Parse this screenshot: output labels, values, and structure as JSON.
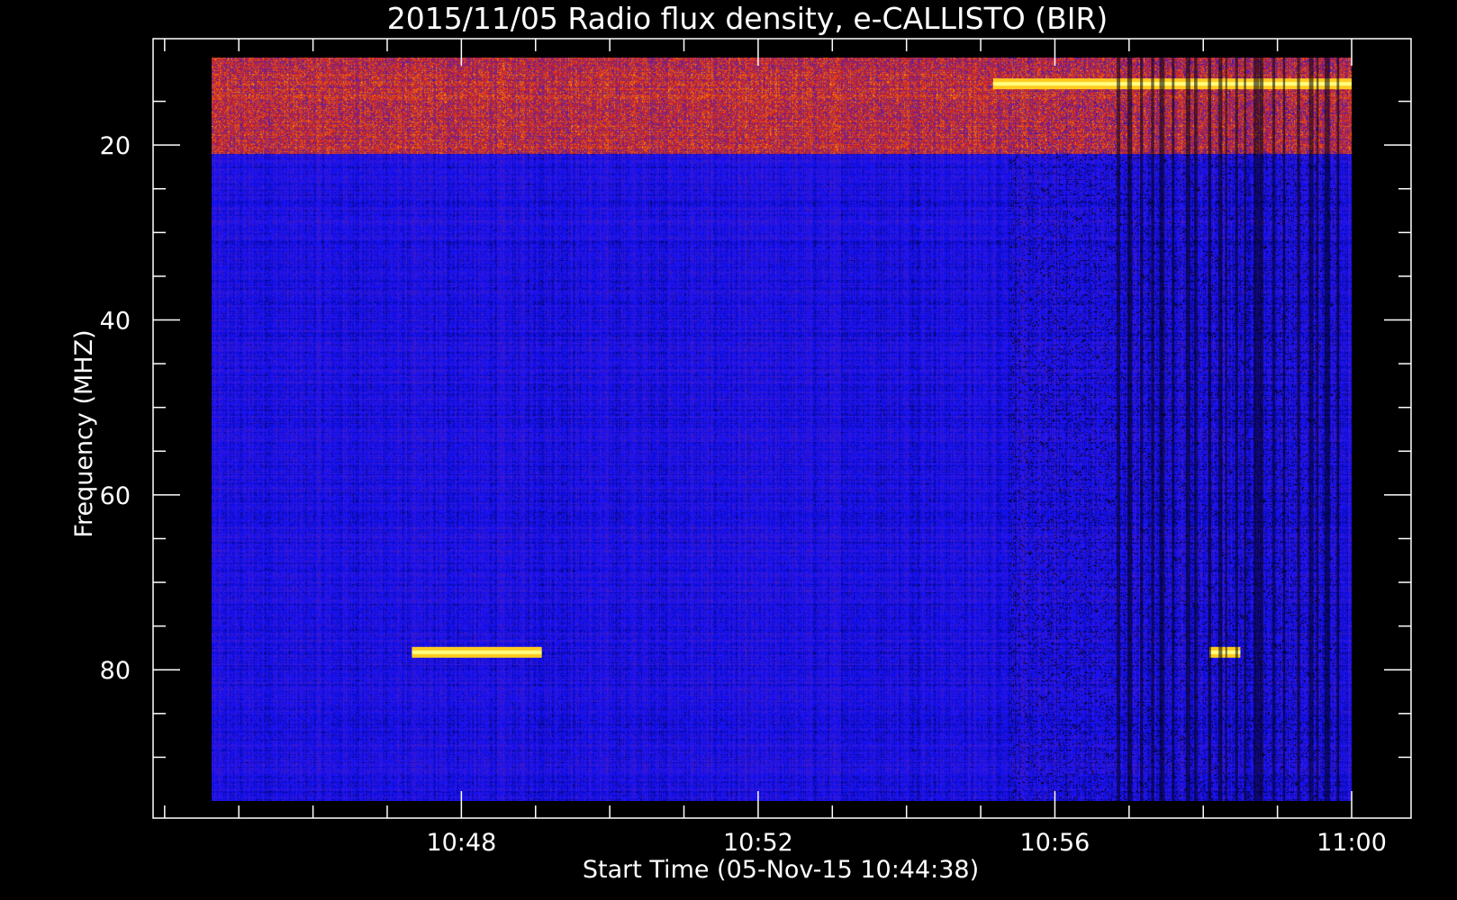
{
  "chart_data": {
    "type": "heatmap",
    "title": "2015/11/05  Radio flux density, e-CALLISTO (BIR)",
    "xlabel": "Start Time (05-Nov-15 10:44:38)",
    "ylabel": "Frequency (MHZ)",
    "x_range": [
      "10:44:38",
      "11:00:00"
    ],
    "y_range": [
      10,
      95
    ],
    "axis_inverted_y": true,
    "x_ticks": [
      "10:48",
      "10:52",
      "10:56",
      "11:00"
    ],
    "y_ticks": [
      20,
      40,
      60,
      80
    ],
    "colormap": [
      "#000000",
      "#1010ff",
      "#6020a0",
      "#d02020",
      "#ff8000",
      "#ffff60"
    ],
    "features": [
      {
        "label": "RFI band",
        "time_start": "10:44:38",
        "time_end": "11:00:00",
        "freq_start": 10,
        "freq_end": 21
      },
      {
        "label": "narrowband 78 MHz",
        "time_start": "10:47:20",
        "time_end": "10:49:05",
        "freq": 78
      },
      {
        "label": "narrowband 78 MHz",
        "time_start": "10:58:05",
        "time_end": "10:58:30",
        "freq": 78
      },
      {
        "label": "narrowband 13 MHz",
        "time_start": "10:55:10",
        "time_end": "11:00:00",
        "freq": 13
      },
      {
        "label": "dark vertical striping",
        "time_start": "10:56:50",
        "time_end": "10:59:50",
        "freq_start": 10,
        "freq_end": 95
      }
    ]
  }
}
